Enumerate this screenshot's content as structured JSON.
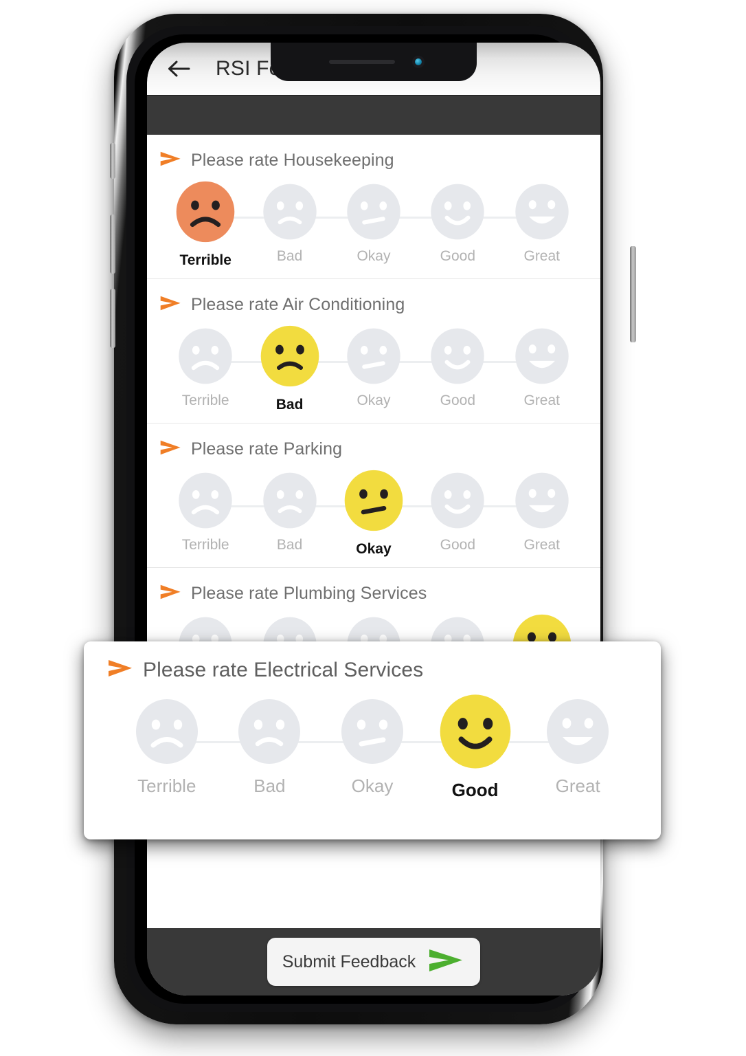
{
  "app": {
    "title": "RSI Feedback",
    "back_icon": "back-arrow-icon"
  },
  "rating_labels": [
    "Terrible",
    "Bad",
    "Okay",
    "Good",
    "Great"
  ],
  "colors": {
    "selected_terrible": "#ED8B5C",
    "selected_yellow": "#F2DC3F",
    "idle_face": "#E6E8EC",
    "accent_orange": "#F07E26",
    "submit_arrow_green": "#4CAF2F",
    "dark_band": "#393939"
  },
  "sections": [
    {
      "title": "Please rate Housekeeping",
      "selected_index": 0,
      "bullet_icon": "orange-arrow-icon"
    },
    {
      "title": "Please rate Air Conditioning",
      "selected_index": 1,
      "bullet_icon": "orange-arrow-icon"
    },
    {
      "title": "Please rate Parking",
      "selected_index": 2,
      "bullet_icon": "orange-arrow-icon"
    },
    {
      "title": "Please rate Plumbing Services",
      "selected_index": 4,
      "bullet_icon": "orange-arrow-icon"
    }
  ],
  "popup": {
    "title": "Please rate Electrical Services",
    "selected_index": 3,
    "bullet_icon": "orange-arrow-icon"
  },
  "bottom": {
    "submit_label": "Submit Feedback",
    "submit_icon": "green-arrow-icon"
  },
  "device": {
    "speaker_icon": "speaker-grille-icon",
    "camera_icon": "front-camera-icon"
  }
}
